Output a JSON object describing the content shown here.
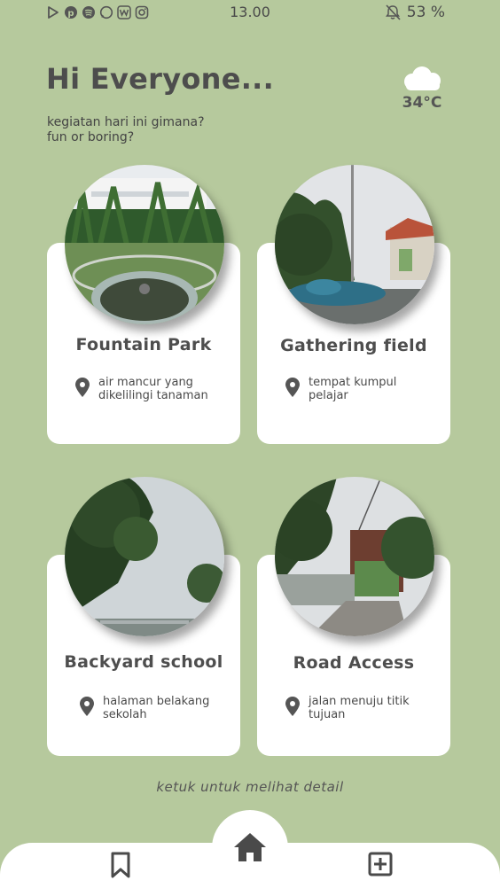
{
  "status_bar": {
    "time": "13.00",
    "battery": "53 %",
    "left_icons": [
      "play-store-icon",
      "pinterest-icon",
      "spotify-icon",
      "whatsapp-icon",
      "wattpad-icon",
      "instagram-icon"
    ],
    "right_icons": [
      "bell-off-icon"
    ]
  },
  "header": {
    "greeting": "Hi Everyone...",
    "subtitle_line1": "kegiatan hari ini gimana?",
    "subtitle_line2": "fun or boring?"
  },
  "weather": {
    "icon": "cloud-icon",
    "temperature": "34°C"
  },
  "places": [
    {
      "title": "Fountain Park",
      "loc_line1": "air mancur yang",
      "loc_line2": "dikelilingi tanaman",
      "photo": "fountain-park-photo"
    },
    {
      "title": "Gathering field",
      "loc_line1": "tempat kumpul",
      "loc_line2": "pelajar",
      "photo": "gathering-field-photo"
    },
    {
      "title": "Backyard school",
      "loc_line1": "halaman belakang",
      "loc_line2": "sekolah",
      "photo": "backyard-school-photo"
    },
    {
      "title": "Road Access",
      "loc_line1": "jalan menuju titik",
      "loc_line2": "tujuan",
      "photo": "road-access-photo"
    }
  ],
  "hint": "ketuk untuk melihat detail",
  "nav": {
    "left_icon": "bookmark-icon",
    "center_icon": "home-icon",
    "right_icon": "add-square-icon"
  },
  "colors": {
    "background": "#b6c99d",
    "card": "#ffffff",
    "text": "#4a4a4a"
  }
}
